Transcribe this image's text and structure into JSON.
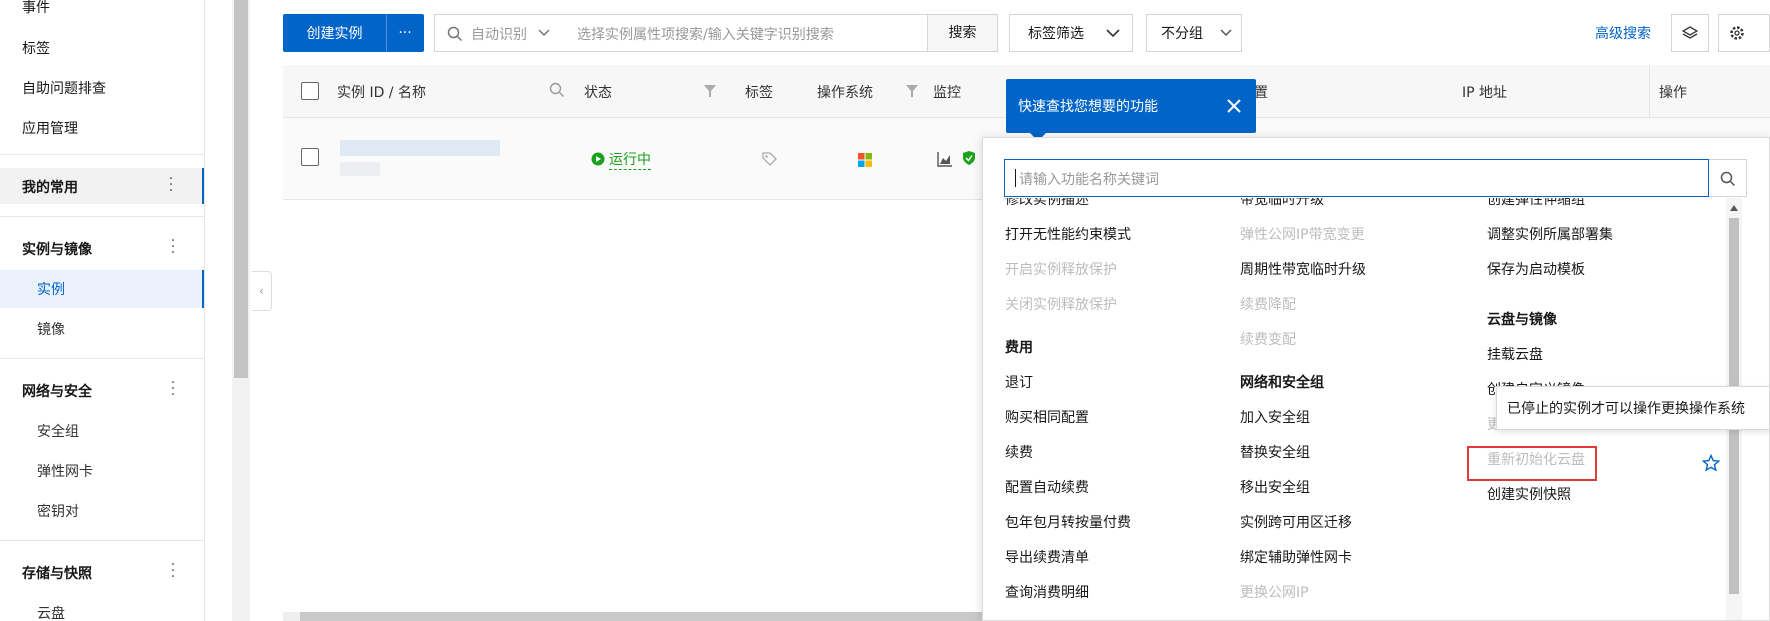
{
  "sidebar": {
    "items_top": [
      "事件",
      "标签",
      "自助问题排查",
      "应用管理"
    ],
    "my_common": "我的常用",
    "groups": [
      {
        "title": "实例与镜像",
        "items": [
          "实例",
          "镜像"
        ]
      },
      {
        "title": "网络与安全",
        "items": [
          "安全组",
          "弹性网卡",
          "密钥对"
        ]
      },
      {
        "title": "存储与快照",
        "items": [
          "云盘"
        ]
      }
    ]
  },
  "toolbar": {
    "create_instance": "创建实例",
    "more": "···",
    "search_scope": "自动识别",
    "search_placeholder": "选择实例属性项搜索/输入关键字识别搜索",
    "search_button": "搜索",
    "tag_filter": "标签筛选",
    "group": "不分组",
    "advanced_search": "高级搜索"
  },
  "table": {
    "columns": [
      "实例 ID / 名称",
      "状态",
      "标签",
      "操作系统",
      "监控",
      "置",
      "IP 地址",
      "操作"
    ],
    "row": {
      "status": "运行中"
    }
  },
  "quick_find": {
    "tip": "快速查找您想要的功能",
    "search_placeholder": "请输入功能名称关键词",
    "col1": [
      {
        "text": "修改实例描述",
        "disabled": false
      },
      {
        "text": "打开无性能约束模式",
        "disabled": false
      },
      {
        "text": "开启实例释放保护",
        "disabled": true
      },
      {
        "text": "关闭实例释放保护",
        "disabled": true
      },
      {
        "text": "费用",
        "head": true
      },
      {
        "text": "退订",
        "disabled": false
      },
      {
        "text": "购买相同配置",
        "disabled": false
      },
      {
        "text": "续费",
        "disabled": false
      },
      {
        "text": "配置自动续费",
        "disabled": false
      },
      {
        "text": "包年包月转按量付费",
        "disabled": false
      },
      {
        "text": "导出续费清单",
        "disabled": false
      },
      {
        "text": "查询消费明细",
        "disabled": false
      }
    ],
    "col2": [
      {
        "text": "带宽临时升级",
        "disabled": false
      },
      {
        "text": "弹性公网IP带宽变更",
        "disabled": true
      },
      {
        "text": "周期性带宽临时升级",
        "disabled": false
      },
      {
        "text": "续费降配",
        "disabled": true
      },
      {
        "text": "续费变配",
        "disabled": true
      },
      {
        "text": "网络和安全组",
        "head": true
      },
      {
        "text": "加入安全组",
        "disabled": false
      },
      {
        "text": "替换安全组",
        "disabled": false
      },
      {
        "text": "移出安全组",
        "disabled": false
      },
      {
        "text": "实例跨可用区迁移",
        "disabled": false
      },
      {
        "text": "绑定辅助弹性网卡",
        "disabled": false
      },
      {
        "text": "更换公网IP",
        "disabled": true
      }
    ],
    "col3": [
      {
        "text": "创建弹性伸缩组",
        "disabled": false
      },
      {
        "text": "调整实例所属部署集",
        "disabled": false
      },
      {
        "text": "保存为启动模板",
        "disabled": false
      },
      {
        "text": "云盘与镜像",
        "head": true
      },
      {
        "text": "挂载云盘",
        "disabled": false
      },
      {
        "text": "创建自定义镜像",
        "disabled": false
      },
      {
        "text": "更换操作系统",
        "disabled": true
      },
      {
        "text": "重新初始化云盘",
        "disabled": true
      },
      {
        "text": "创建实例快照",
        "disabled": false
      }
    ],
    "hover_tip": "已停止的实例才可以操作更换操作系统"
  },
  "colors": {
    "primary": "#0064c8",
    "running": "#1ba11b",
    "highlight": "#e03a3a"
  }
}
